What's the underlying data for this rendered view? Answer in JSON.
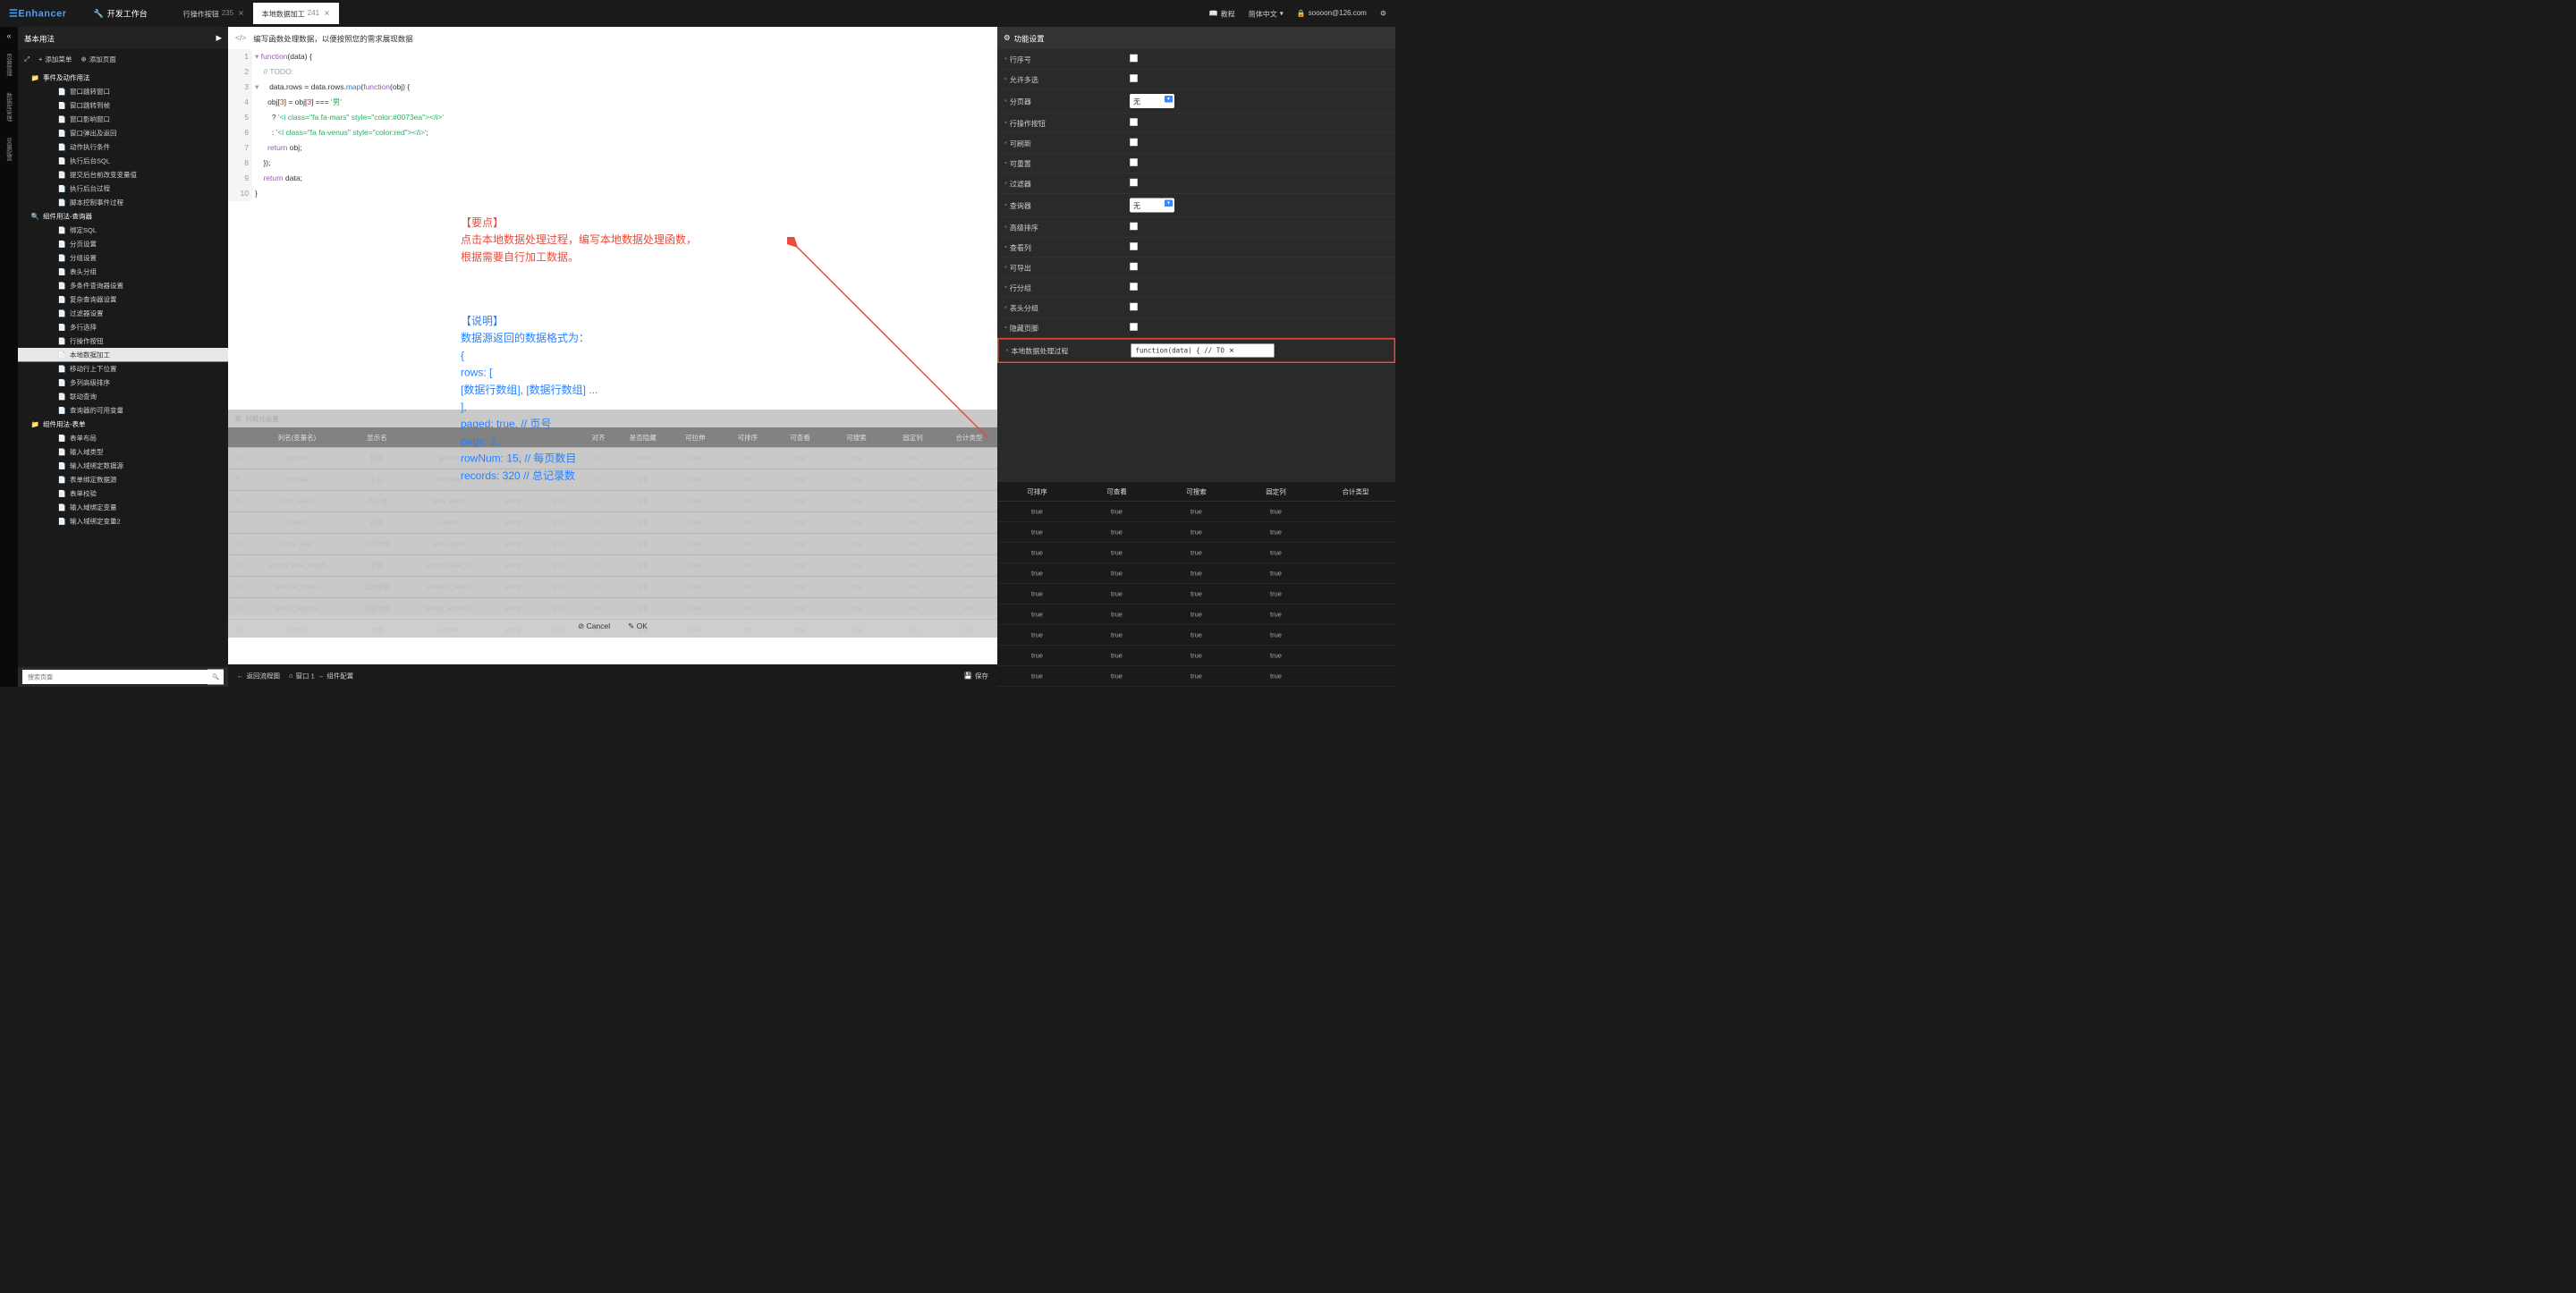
{
  "brand": "Enhancer",
  "workbench_label": "开发工作台",
  "top_tabs": [
    {
      "label": "行操作按钮",
      "num": "235"
    },
    {
      "label": "本地数据加工",
      "num": "241"
    }
  ],
  "tutorial": "教程",
  "language": "简体中文",
  "user": "soooon@126.com",
  "sidebar_title": "基本用法",
  "add_menu": "添加菜单",
  "add_page": "添加页面",
  "tree": {
    "folder1": "事件及动作用法",
    "items1": [
      "窗口跳转窗口",
      "窗口跳转到帧",
      "窗口影响窗口",
      "窗口弹出及返回",
      "动作执行条件",
      "执行后台SQL",
      "提交后台前改变变量值",
      "执行后台过程",
      "脚本控制事件过程"
    ],
    "folder2": "组件用法-查询器",
    "items2": [
      "绑定SQL",
      "分页设置",
      "分组设置",
      "表头分组",
      "多条件查询器设置",
      "复杂查询器设置",
      "过滤器设置",
      "多行选择",
      "行操作按钮",
      "本地数据加工",
      "移动行上下位置",
      "多列高级排序",
      "联动查询",
      "查询器的可用变量"
    ],
    "folder3": "组件用法-表单",
    "items3": [
      "表单布局",
      "输入域类型",
      "输入域绑定数据源",
      "表单绑定数据源",
      "表单校验",
      "输入域绑定变量",
      "输入域绑定变量2"
    ]
  },
  "search_placeholder": "搜索页面",
  "editor_title": "编写函数处理数据，以便按照您的需求展现数据",
  "code": {
    "l1a": "function",
    "l1b": "(data) {",
    "l2": "    // TODO:",
    "l3a": "    data.rows = data.rows.",
    "l3b": "map",
    "l3c": "(",
    "l3d": "function",
    "l3e": "(obj) {",
    "l4a": "      obj[",
    "l4b": "3",
    "l4c": "] = obj[",
    "l4d": "3",
    "l4e": "] === ",
    "l4f": "'男'",
    "l5a": "        ? ",
    "l5b": "'<i class=\"fa fa-mars\" style=\"color:#0073ea\"></i>'",
    "l6a": "        : ",
    "l6b": "'<i class=\"fa fa-venus\" style=\"color:red\"></i>'",
    "l6c": ";",
    "l7a": "      ",
    "l7b": "return",
    "l7c": " obj;",
    "l8": "    });",
    "l9a": "    ",
    "l9b": "return",
    "l9c": " data;",
    "l10": "}"
  },
  "annot": {
    "head1": "【要点】",
    "line1": "点击本地数据处理过程，编写本地数据处理函数，",
    "line2": "根据需要自行加工数据。",
    "head2": "【说明】",
    "line3": "数据源返回的数据格式为：",
    "line4": "{",
    "line5": "  rows: [",
    "line6": "    [数据行数组], [数据行数组] ...",
    "line7": "  ],",
    "line8": "  paged: true,   // 页号",
    "line9": "  page: 2,",
    "line10": "  rowNum: 15,   // 每页数目",
    "line11": "  records: 320  // 总记录数"
  },
  "bt": {
    "title": "列模式设置",
    "headers": [
      "",
      "列名(变量名)",
      "显示名",
      "",
      "",
      "",
      "对齐",
      "是否隐藏",
      "可拉伸",
      "可排序",
      "可查看",
      "可搜索",
      "固定列",
      "合计类型"
    ],
    "rows": [
      {
        "n": "4",
        "a": "gender",
        "b": "性别",
        "c": "gender",
        "d": "string",
        "e": "text",
        "f": "60",
        "g": "center",
        "h": "false",
        "i": "true",
        "j": "true",
        "k": "true",
        "l": "true",
        "m": "true"
      },
      {
        "n": "5",
        "a": "birthday",
        "b": "生日",
        "c": "birthday",
        "d": "string",
        "e": "text",
        "f": "60",
        "g": "left",
        "h": "false",
        "i": "true",
        "j": "true",
        "k": "true",
        "l": "true",
        "m": "true"
      },
      {
        "n": "6",
        "a": "birth_place",
        "b": "出生地",
        "c": "birth_place",
        "d": "string",
        "e": "text",
        "f": "60",
        "g": "left",
        "h": "false",
        "i": "true",
        "j": "true",
        "k": "true",
        "l": "true",
        "m": "true"
      },
      {
        "n": "7",
        "a": "nation",
        "b": "民族",
        "c": "nation",
        "d": "string",
        "e": "text",
        "f": "60",
        "g": "left",
        "h": "false",
        "i": "true",
        "j": "true",
        "k": "true",
        "l": "true",
        "m": "true"
      },
      {
        "n": "8",
        "a": "entry_year",
        "b": "入学年份",
        "c": "entry_year",
        "d": "string",
        "e": "text",
        "f": "60",
        "g": "left",
        "h": "false",
        "i": "true",
        "j": "true",
        "k": "true",
        "l": "true",
        "m": "true"
      },
      {
        "n": "9",
        "a": "school_year_length",
        "b": "学制",
        "c": "school_year_le",
        "d": "string",
        "e": "text",
        "f": "60",
        "g": "left",
        "h": "false",
        "i": "true",
        "j": "true",
        "k": "true",
        "l": "true",
        "m": "true"
      },
      {
        "n": "10",
        "a": "political_status",
        "b": "政治面貌",
        "c": "political_status",
        "d": "string",
        "e": "text",
        "f": "60",
        "g": "left",
        "h": "false",
        "i": "true",
        "j": "true",
        "k": "true",
        "l": "true",
        "m": "true"
      },
      {
        "n": "11",
        "a": "family_address",
        "b": "家庭地址",
        "c": "family_address",
        "d": "string",
        "e": "text",
        "f": "140",
        "g": "left",
        "h": "false",
        "i": "true",
        "j": "true",
        "k": "true",
        "l": "true",
        "m": "true"
      },
      {
        "n": "12",
        "a": "phone",
        "b": "电话",
        "c": "phone",
        "d": "string",
        "e": "text",
        "f": "60",
        "g": "left",
        "h": "false",
        "i": "true",
        "j": "true",
        "k": "true",
        "l": "true",
        "m": "true"
      }
    ]
  },
  "cancel": "Cancel",
  "ok": "OK",
  "footer": {
    "back": "返回流程图",
    "win": "窗口 1",
    "cfg": "组件配置",
    "save": "保存"
  },
  "rp": {
    "title": "功能设置",
    "items": [
      "行序号",
      "允许多选",
      "分页器",
      "行操作按钮",
      "可刷新",
      "可重置",
      "过滤器",
      "查询器",
      "高级排序",
      "查看列",
      "可导出",
      "行分组",
      "表头分组",
      "隐藏页脚",
      "本地数据处理过程"
    ],
    "sel_none": "无",
    "func_text": "function(data) {    // TO",
    "table_headers": [
      "可排序",
      "可查看",
      "可搜索",
      "固定列",
      "合计类型"
    ]
  }
}
